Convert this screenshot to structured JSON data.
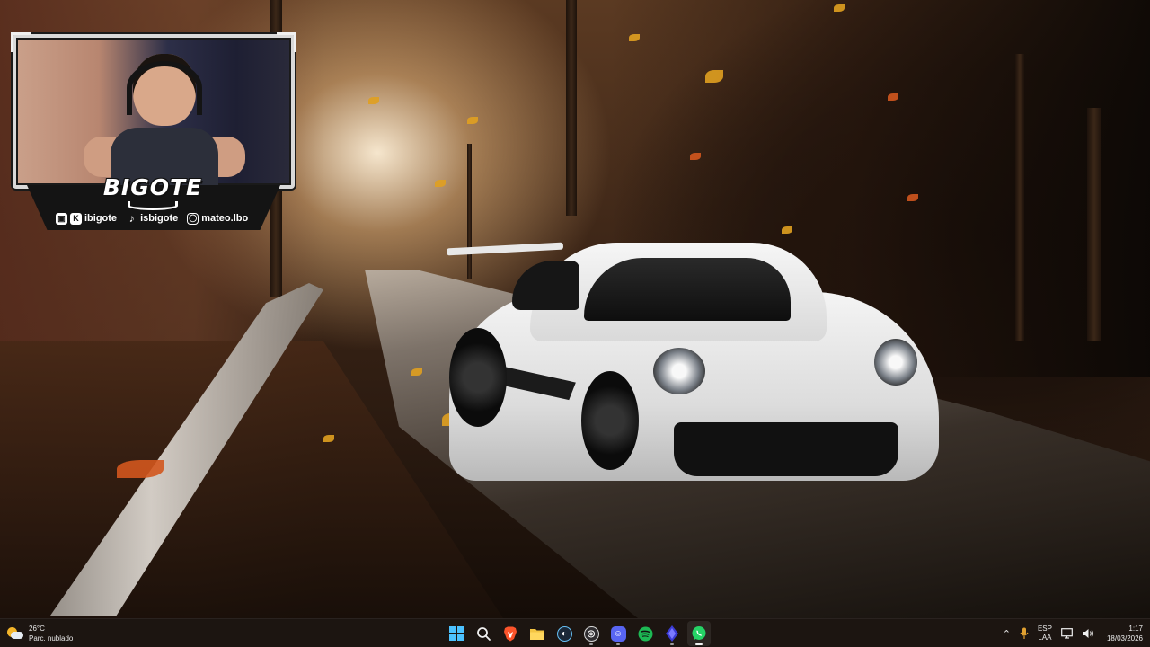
{
  "overlay": {
    "brand": "BIGOTE",
    "socials": [
      {
        "platform": "twitch-kick",
        "icon": "twitch-icon",
        "handle": "ibigote"
      },
      {
        "platform": "tiktok",
        "icon": "tiktok-icon",
        "handle": "isbigote"
      },
      {
        "platform": "instagram",
        "icon": "instagram-icon",
        "handle": "mateo.lbo"
      }
    ]
  },
  "taskbar": {
    "weather": {
      "temp": "26°C",
      "condition": "Parc. nublado",
      "icon": "partly-cloudy-icon"
    },
    "pinned": [
      {
        "name": "start-button",
        "icon": "windows-icon",
        "state": "normal"
      },
      {
        "name": "search-button",
        "icon": "search-icon",
        "state": "normal"
      },
      {
        "name": "brave-button",
        "icon": "brave-icon",
        "state": "normal",
        "color": "#fb542b"
      },
      {
        "name": "file-explorer-button",
        "icon": "folder-icon",
        "state": "normal",
        "color": "#f4c542"
      },
      {
        "name": "steam-button",
        "icon": "steam-icon",
        "state": "normal",
        "color": "#1b2838"
      },
      {
        "name": "obs-button",
        "icon": "obs-icon",
        "state": "running",
        "color": "#302e31"
      },
      {
        "name": "discord-button",
        "icon": "discord-icon",
        "state": "running",
        "color": "#5865f2"
      },
      {
        "name": "spotify-button",
        "icon": "spotify-icon",
        "state": "normal",
        "color": "#1db954"
      },
      {
        "name": "app-button",
        "icon": "diamond-app-icon",
        "state": "running",
        "color": "#3b3bd6"
      },
      {
        "name": "whatsapp-button",
        "icon": "whatsapp-icon",
        "state": "active",
        "color": "#25d366"
      }
    ],
    "tray": {
      "language_line1": "ESP",
      "language_line2": "LAA",
      "time": "1:17",
      "date": "18/03/2026"
    }
  },
  "colors": {
    "taskbar_bg": "#1c1612",
    "windows_accent": "#4cc2ff"
  }
}
